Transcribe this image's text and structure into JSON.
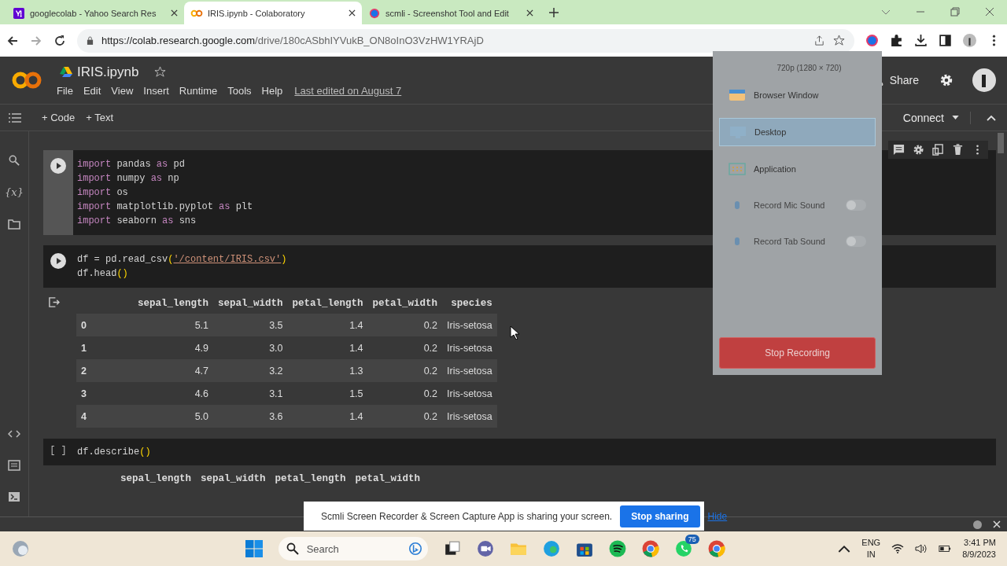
{
  "browser": {
    "tabs": [
      {
        "title": "googlecolab - Yahoo Search Res",
        "kind": "yahoo",
        "selected": false
      },
      {
        "title": "IRIS.ipynb - Colaboratory",
        "kind": "colab",
        "selected": true
      },
      {
        "title": "scmli - Screenshot Tool and Edit",
        "kind": "globe",
        "selected": false
      }
    ],
    "url_host": "https://colab.research.google.com",
    "url_path": "/drive/180cASbhIYVukB_ON8oInO3VzHW1YRAjD"
  },
  "colab": {
    "title": "IRIS.ipynb",
    "menu": [
      "File",
      "Edit",
      "View",
      "Insert",
      "Runtime",
      "Tools",
      "Help"
    ],
    "last_edited": "Last edited on August 7",
    "share": "Share",
    "toolbar": [
      "+ Code",
      "+ Text"
    ],
    "connect": "Connect",
    "variables_icon": "{x}"
  },
  "cells": [
    {
      "kind": "run",
      "lines": [
        [
          {
            "t": "import",
            "kind": "kw"
          },
          {
            "t": " pandas ",
            "kind": "plain"
          },
          {
            "t": "as",
            "kind": "kw"
          },
          {
            "t": " pd",
            "kind": "plain"
          }
        ],
        [
          {
            "t": "import",
            "kind": "kw"
          },
          {
            "t": " numpy ",
            "kind": "plain"
          },
          {
            "t": "as",
            "kind": "kw"
          },
          {
            "t": " np",
            "kind": "plain"
          }
        ],
        [
          {
            "t": "import",
            "kind": "kw"
          },
          {
            "t": " os",
            "kind": "plain"
          }
        ],
        [
          {
            "t": "import",
            "kind": "kw"
          },
          {
            "t": " matplotlib.pyplot ",
            "kind": "plain"
          },
          {
            "t": "as",
            "kind": "kw"
          },
          {
            "t": " plt",
            "kind": "plain"
          }
        ],
        [
          {
            "t": "import",
            "kind": "kw"
          },
          {
            "t": " seaborn ",
            "kind": "plain"
          },
          {
            "t": "as",
            "kind": "kw"
          },
          {
            "t": " sns",
            "kind": "plain"
          }
        ]
      ]
    },
    {
      "kind": "run",
      "lines": [
        [
          {
            "t": "df = pd.read_csv",
            "kind": "plain"
          },
          {
            "t": "(",
            "kind": "paren"
          },
          {
            "t": "'/content/IRIS.csv'",
            "kind": "str"
          },
          {
            "t": ")",
            "kind": "paren"
          }
        ],
        [
          {
            "t": "df.head",
            "kind": "plain"
          },
          {
            "t": "()",
            "kind": "paren"
          }
        ]
      ]
    }
  ],
  "output_table": {
    "columns": [
      "",
      "sepal_length",
      "sepal_width",
      "petal_length",
      "petal_width",
      "species"
    ],
    "rows": [
      [
        "0",
        "5.1",
        "3.5",
        "1.4",
        "0.2",
        "Iris-setosa"
      ],
      [
        "1",
        "4.9",
        "3.0",
        "1.4",
        "0.2",
        "Iris-setosa"
      ],
      [
        "2",
        "4.7",
        "3.2",
        "1.3",
        "0.2",
        "Iris-setosa"
      ],
      [
        "3",
        "4.6",
        "3.1",
        "1.5",
        "0.2",
        "Iris-setosa"
      ],
      [
        "4",
        "5.0",
        "3.6",
        "1.4",
        "0.2",
        "Iris-setosa"
      ]
    ]
  },
  "describe_cell": {
    "prompt": "[ ]",
    "lines": [
      [
        {
          "t": "df.describe",
          "kind": "plain"
        },
        {
          "t": "()",
          "kind": "paren"
        }
      ]
    ],
    "columns": [
      "sepal_length",
      "sepal_width",
      "petal_length",
      "petal_width"
    ]
  },
  "recorder_popup": {
    "resolution": "720p (1280 × 720)",
    "options": [
      {
        "label": "Browser Window",
        "kind": "browser",
        "selected": false
      },
      {
        "label": "Desktop",
        "kind": "desktop",
        "selected": true
      },
      {
        "label": "Application",
        "kind": "app",
        "selected": false
      }
    ],
    "sound": [
      {
        "label": "Record Mic Sound",
        "on": false
      },
      {
        "label": "Record Tab Sound",
        "on": false
      }
    ],
    "stop": "Stop Recording"
  },
  "share_bar": {
    "message": "Scmli Screen Recorder & Screen Capture App is sharing your screen.",
    "stop": "Stop sharing",
    "hide": "Hide"
  },
  "taskbar": {
    "search": "Search",
    "whatsapp_badge": "75",
    "lang": "ENG",
    "region": "IN",
    "time": "3:41 PM",
    "date": "8/9/2023"
  }
}
